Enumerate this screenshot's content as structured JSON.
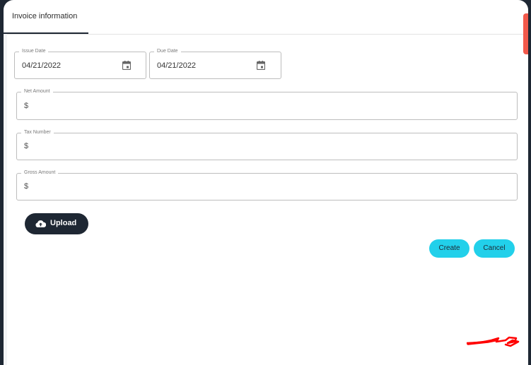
{
  "tabs": [
    {
      "label": "Invoice information",
      "active": true
    }
  ],
  "form": {
    "issue_date": {
      "label": "Issue Date",
      "value": "04/21/2022"
    },
    "due_date": {
      "label": "Due Date",
      "value": "04/21/2022"
    },
    "net_amount": {
      "label": "Net Amount",
      "prefix": "$",
      "value": ""
    },
    "tax_number": {
      "label": "Tax Number",
      "prefix": "$",
      "value": ""
    },
    "gross_amount": {
      "label": "Gross Amount",
      "prefix": "$",
      "value": ""
    }
  },
  "buttons": {
    "upload": "Upload",
    "create": "Create",
    "cancel": "Cancel"
  },
  "colors": {
    "primary_dark": "#1e2733",
    "accent": "#22d0ea",
    "scrollbar": "#f2594b",
    "signature": "#ff0000"
  }
}
